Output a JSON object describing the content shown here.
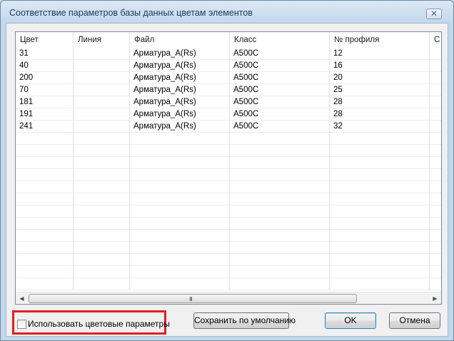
{
  "window": {
    "title": "Соответствие параметров базы данных цветам элементов",
    "close_glyph": "✕"
  },
  "table": {
    "columns": [
      "Цвет",
      "Линия",
      "Файл",
      "Класс",
      "№ профиля",
      "С"
    ],
    "rows": [
      [
        "31",
        "",
        "Арматура_А(Rs)",
        "А500С",
        "12"
      ],
      [
        "40",
        "",
        "Арматура_А(Rs)",
        "А500С",
        "16"
      ],
      [
        "200",
        "",
        "Арматура_А(Rs)",
        "А500С",
        "20"
      ],
      [
        "70",
        "",
        "Арматура_А(Rs)",
        "А500С",
        "25"
      ],
      [
        "181",
        "",
        "Арматура_А(Rs)",
        "А500С",
        "28"
      ],
      [
        "191",
        "",
        "Арматура_А(Rs)",
        "А500С",
        "28"
      ],
      [
        "241",
        "",
        "Арматура_А(Rs)",
        "А500С",
        "32"
      ]
    ]
  },
  "scrollbar": {
    "left_arrow": "◀",
    "right_arrow": "▶",
    "grip": "III"
  },
  "options": {
    "use_color_params_label": "Использовать цветовые параметры",
    "use_color_params_checked": false
  },
  "buttons": {
    "save_default": "Сохранить по умолчанию",
    "ok": "OK",
    "cancel": "Отмена"
  }
}
